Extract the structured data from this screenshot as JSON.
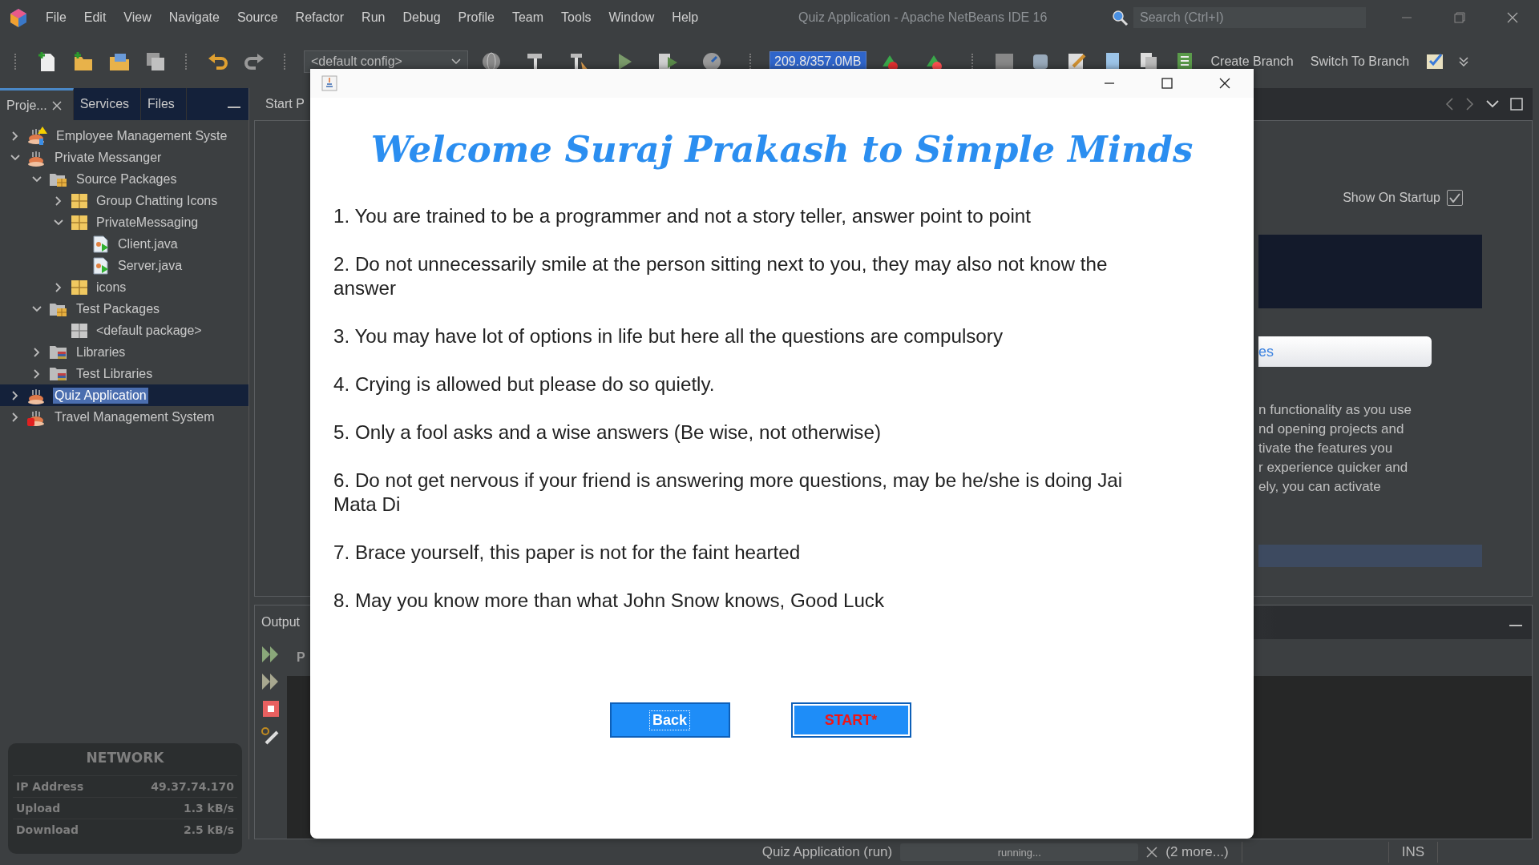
{
  "window": {
    "title": "Quiz Application - Apache NetBeans IDE 16"
  },
  "menu": [
    "File",
    "Edit",
    "View",
    "Navigate",
    "Source",
    "Refactor",
    "Run",
    "Debug",
    "Profile",
    "Team",
    "Tools",
    "Window",
    "Help"
  ],
  "search": {
    "placeholder": "Search (Ctrl+I)"
  },
  "toolbar": {
    "config": "<default config>",
    "memory": "209.8/357.0MB",
    "buttons": [
      "Create Branch",
      "Switch To Branch"
    ]
  },
  "projects_panel": {
    "tabs": [
      {
        "label": "Proje...",
        "selected": true,
        "closable": true
      },
      {
        "label": "Services",
        "selected": false,
        "closable": false
      },
      {
        "label": "Files",
        "selected": false,
        "closable": false
      }
    ],
    "tree": [
      {
        "label": "Employee Management Syste",
        "kind": "project-warning",
        "expanded": false,
        "selected": false
      },
      {
        "label": "Private Messanger",
        "kind": "project",
        "expanded": true,
        "selected": false,
        "children": [
          {
            "label": "Source Packages",
            "kind": "source-folder",
            "expanded": true,
            "selected": false,
            "children": [
              {
                "label": "Group Chatting Icons",
                "kind": "package",
                "expanded": false,
                "selected": false
              },
              {
                "label": "PrivateMessaging",
                "kind": "package",
                "expanded": true,
                "selected": false,
                "children": [
                  {
                    "label": "Client.java",
                    "kind": "java-file",
                    "selected": false
                  },
                  {
                    "label": "Server.java",
                    "kind": "java-file",
                    "selected": false
                  }
                ]
              },
              {
                "label": "icons",
                "kind": "package",
                "expanded": false,
                "selected": false
              }
            ]
          },
          {
            "label": "Test Packages",
            "kind": "source-folder",
            "expanded": true,
            "selected": false,
            "children": [
              {
                "label": "<default package>",
                "kind": "empty-package",
                "selected": false
              }
            ]
          },
          {
            "label": "Libraries",
            "kind": "library",
            "expanded": false,
            "selected": false
          },
          {
            "label": "Test Libraries",
            "kind": "library",
            "expanded": false,
            "selected": false
          }
        ]
      },
      {
        "label": "Quiz Application",
        "kind": "project",
        "expanded": false,
        "selected": true
      },
      {
        "label": "Travel Management System",
        "kind": "project-error",
        "expanded": false,
        "selected": false
      }
    ]
  },
  "editor": {
    "tab": "Start P",
    "show_on_startup": {
      "label": "Show On Startup",
      "checked": true
    },
    "button_fragment": "es",
    "text_fragments": [
      "n functionality as you use",
      "nd opening projects and",
      "tivate the features you",
      "r experience quicker and",
      "ely, you can activate"
    ]
  },
  "output": {
    "title": "Output",
    "tab_fragment": "P"
  },
  "dialog": {
    "heading": "Welcome Suraj Prakash to Simple Minds",
    "rules": [
      "1. You are trained to be a programmer and not a story teller, answer point to point",
      "2. Do not unnecessarily smile at the person sitting next to you, they may also not know the answer",
      "3. You may have lot of options in life but here all the questions are compulsory",
      "4. Crying is allowed but please do so quietly.",
      "5. Only a fool asks and a wise answers (Be wise, not otherwise)",
      "6. Do not get nervous if your friend is answering more questions, may be he/she is doing Jai Mata Di",
      "7. Brace yourself, this paper is not for the faint hearted",
      "8. May you know more than what John Snow knows, Good Luck"
    ],
    "buttons": [
      {
        "label": "Back",
        "kind": "back"
      },
      {
        "label": "START*",
        "kind": "start"
      }
    ]
  },
  "status_bar": {
    "task": "Quiz Application (run)",
    "progress": "running...",
    "more": "(2 more...)",
    "mode": "INS"
  },
  "network_widget": {
    "title": "NETWORK",
    "rows": [
      {
        "label": "IP Address",
        "value": "49.37.74.170"
      },
      {
        "label": "Upload",
        "value": "1.3 kB/s"
      },
      {
        "label": "Download",
        "value": "2.5 kB/s"
      }
    ]
  }
}
